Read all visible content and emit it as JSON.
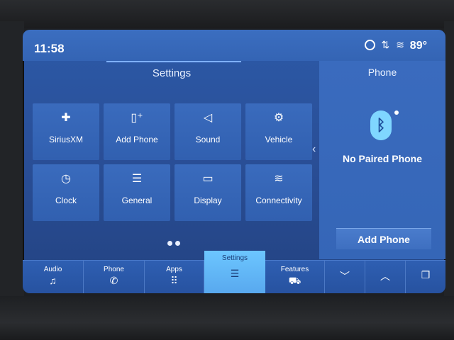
{
  "status": {
    "time": "11:58",
    "temperature": "89°",
    "icons": [
      "siri-ring-icon",
      "signal-icon",
      "wifi-icon"
    ]
  },
  "settings": {
    "title": "Settings",
    "tiles": [
      {
        "label": "SiriusXM",
        "icon": "satellite-icon",
        "glyph": "✚"
      },
      {
        "label": "Add Phone",
        "icon": "add-phone-icon",
        "glyph": "▯⁺"
      },
      {
        "label": "Sound",
        "icon": "speaker-icon",
        "glyph": "◁"
      },
      {
        "label": "Vehicle",
        "icon": "vehicle-settings-icon",
        "glyph": "⚙"
      },
      {
        "label": "Clock",
        "icon": "clock-icon",
        "glyph": "◷"
      },
      {
        "label": "General",
        "icon": "sliders-icon",
        "glyph": "☰"
      },
      {
        "label": "Display",
        "icon": "display-icon",
        "glyph": "▭"
      },
      {
        "label": "Connectivity",
        "icon": "wifi-icon",
        "glyph": "≋"
      }
    ]
  },
  "phone": {
    "title": "Phone",
    "status": "No Paired Phone",
    "add_button": "Add Phone"
  },
  "nav": [
    {
      "label": "Audio",
      "icon": "music-note-icon",
      "glyph": "♫"
    },
    {
      "label": "Phone",
      "icon": "phone-icon",
      "glyph": "✆"
    },
    {
      "label": "Apps",
      "icon": "apps-grid-icon",
      "glyph": "⠿"
    },
    {
      "label": "Settings",
      "icon": "settings-sliders-icon",
      "glyph": "☰",
      "active": true
    },
    {
      "label": "Features",
      "icon": "car-icon",
      "glyph": "⛟"
    },
    {
      "label": "",
      "icon": "chevron-down-icon",
      "glyph": "﹀"
    },
    {
      "label": "",
      "icon": "chevron-up-icon",
      "glyph": "︿"
    },
    {
      "label": "",
      "icon": "copy-icon",
      "glyph": "❐"
    }
  ],
  "colors": {
    "screen_blue": "#2c5aa8",
    "active_tab": "#6cc6ff",
    "bluetooth": "#7fd6ff"
  }
}
